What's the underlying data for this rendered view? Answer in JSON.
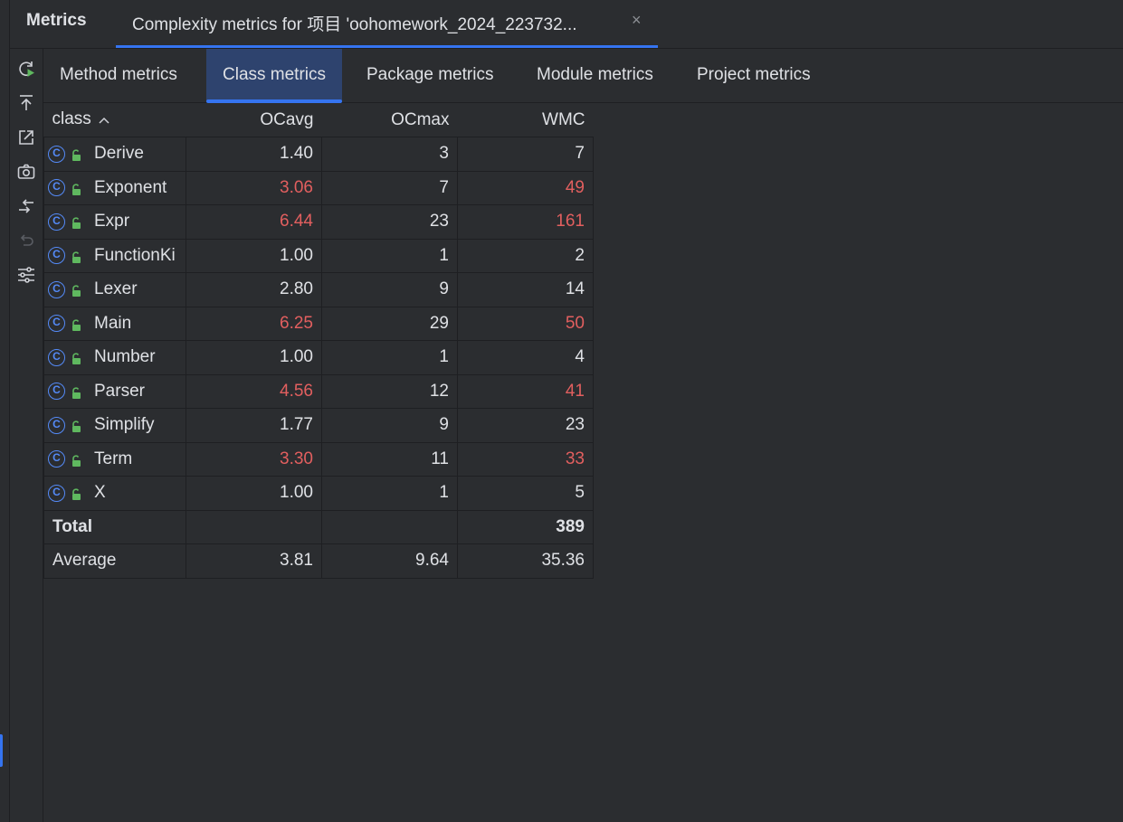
{
  "toolwindow": {
    "title": "Metrics",
    "tab_label": "Complexity metrics for 项目 'oohomework_2024_223732...",
    "close_glyph": "×"
  },
  "toolbar": {
    "icons": [
      "refresh-run-icon",
      "export-icon",
      "open-external-icon",
      "snapshot-camera-icon",
      "compare-arrows-icon",
      "undo-icon",
      "settings-sliders-icon"
    ]
  },
  "subtabs": [
    "Method metrics",
    "Class metrics",
    "Package metrics",
    "Module metrics",
    "Project metrics"
  ],
  "active_subtab": "Class metrics",
  "table": {
    "headers": {
      "class": "class",
      "ocavg": "OCavg",
      "ocmax": "OCmax",
      "wmc": "WMC"
    },
    "rows": [
      {
        "name": "Derive",
        "ocavg": "1.40",
        "ocmax": "3",
        "wmc": "7",
        "ocavg_hot": false,
        "wmc_hot": false
      },
      {
        "name": "Exponent",
        "ocavg": "3.06",
        "ocmax": "7",
        "wmc": "49",
        "ocavg_hot": true,
        "wmc_hot": true
      },
      {
        "name": "Expr",
        "ocavg": "6.44",
        "ocmax": "23",
        "wmc": "161",
        "ocavg_hot": true,
        "wmc_hot": true
      },
      {
        "name": "FunctionKi",
        "ocavg": "1.00",
        "ocmax": "1",
        "wmc": "2",
        "ocavg_hot": false,
        "wmc_hot": false
      },
      {
        "name": "Lexer",
        "ocavg": "2.80",
        "ocmax": "9",
        "wmc": "14",
        "ocavg_hot": false,
        "wmc_hot": false
      },
      {
        "name": "Main",
        "ocavg": "6.25",
        "ocmax": "29",
        "wmc": "50",
        "ocavg_hot": true,
        "wmc_hot": true
      },
      {
        "name": "Number",
        "ocavg": "1.00",
        "ocmax": "1",
        "wmc": "4",
        "ocavg_hot": false,
        "wmc_hot": false
      },
      {
        "name": "Parser",
        "ocavg": "4.56",
        "ocmax": "12",
        "wmc": "41",
        "ocavg_hot": true,
        "wmc_hot": true
      },
      {
        "name": "Simplify",
        "ocavg": "1.77",
        "ocmax": "9",
        "wmc": "23",
        "ocavg_hot": false,
        "wmc_hot": false
      },
      {
        "name": "Term",
        "ocavg": "3.30",
        "ocmax": "11",
        "wmc": "33",
        "ocavg_hot": true,
        "wmc_hot": true
      },
      {
        "name": "X",
        "ocavg": "1.00",
        "ocmax": "1",
        "wmc": "5",
        "ocavg_hot": false,
        "wmc_hot": false
      }
    ],
    "total": {
      "label": "Total",
      "ocavg": "",
      "ocmax": "",
      "wmc": "389"
    },
    "average": {
      "label": "Average",
      "ocavg": "3.81",
      "ocmax": "9.64",
      "wmc": "35.36"
    },
    "class_icon_letter": "C"
  },
  "colors": {
    "background": "#2b2d30",
    "accent": "#3574f0",
    "active_tab_bg": "#2e436e",
    "hot_value": "#e25f5f",
    "class_icon": "#548af7",
    "lock_icon": "#5fb85f"
  }
}
